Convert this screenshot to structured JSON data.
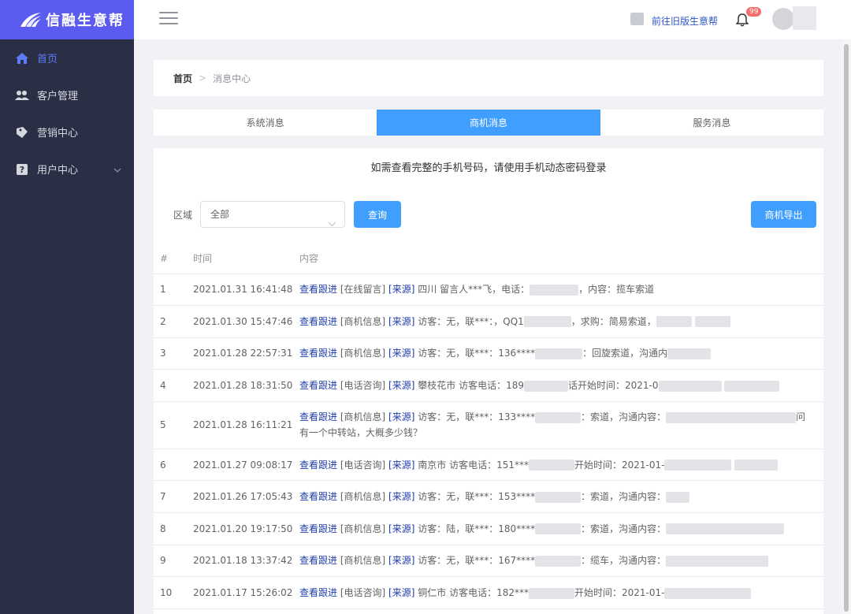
{
  "app": {
    "logo_text": "信融生意帮"
  },
  "sidebar": {
    "items": [
      {
        "label": "首页",
        "icon": "home-icon",
        "active": true
      },
      {
        "label": "客户管理",
        "icon": "users-icon",
        "active": false
      },
      {
        "label": "营销中心",
        "icon": "tag-icon",
        "active": false
      },
      {
        "label": "用户中心",
        "icon": "help-icon",
        "active": false
      }
    ]
  },
  "topbar": {
    "old_version_link": "前往旧版生意帮",
    "notification_count": "99"
  },
  "breadcrumb": {
    "home": "首页",
    "separator": ">",
    "current": "消息中心"
  },
  "tabs": [
    {
      "label": "系统消息",
      "active": false
    },
    {
      "label": "商机消息",
      "active": true
    },
    {
      "label": "服务消息",
      "active": false
    }
  ],
  "notice": "如需查看完整的手机号码，请使用手机动态密码登录",
  "filter": {
    "label": "区域",
    "selected": "全部",
    "query_button": "查询",
    "export_button": "商机导出"
  },
  "table": {
    "headers": [
      "#",
      "时间",
      "内容"
    ],
    "follow_label": "查看跟进",
    "rows": [
      {
        "index": "1",
        "time": "2021.01.31 16:41:48",
        "type": "[在线留言]",
        "source": "[来源]",
        "text_a": "四川 留言人***飞，电话：",
        "text_b": "，内容：揽车索道",
        "text_c": ""
      },
      {
        "index": "2",
        "time": "2021.01.30 15:47:46",
        "type": "[商机信息]",
        "source": "[来源]",
        "text_a": "访客：无，联***：，QQ1",
        "text_b": "，求购：简易索道，",
        "text_c": ""
      },
      {
        "index": "3",
        "time": "2021.01.28 22:57:31",
        "type": "[商机信息]",
        "source": "[来源]",
        "text_a": "访客：无，联***：136****",
        "text_b": "：回旋索道，沟通内",
        "text_c": ""
      },
      {
        "index": "4",
        "time": "2021.01.28 18:31:50",
        "type": "[电话咨询]",
        "source": "[来源]",
        "text_a": "攀枝花市 访客电话：189",
        "text_b": "话开始时间：2021-0",
        "text_c": ""
      },
      {
        "index": "5",
        "time": "2021.01.28 16:11:21",
        "type": "[商机信息]",
        "source": "[来源]",
        "text_a": "访客：无，联***：133****",
        "text_b": "：索道，沟通内容：",
        "text_c": "问",
        "text_line2": "有一个中转站，大概多少钱？"
      },
      {
        "index": "6",
        "time": "2021.01.27 09:08:17",
        "type": "[电话咨询]",
        "source": "[来源]",
        "text_a": "南京市 访客电话：151***",
        "text_b": "开始时间：2021-01-",
        "text_c": ""
      },
      {
        "index": "7",
        "time": "2021.01.26 17:05:43",
        "type": "[商机信息]",
        "source": "[来源]",
        "text_a": "访客：无，联***：153****",
        "text_b": "：索道，沟通内容：",
        "text_c": ""
      },
      {
        "index": "8",
        "time": "2021.01.20 19:17:50",
        "type": "[商机信息]",
        "source": "[来源]",
        "text_a": "访客：陆，联***：180****",
        "text_b": "：索道，沟通内容：",
        "text_c": ""
      },
      {
        "index": "9",
        "time": "2021.01.18 13:37:42",
        "type": "[商机信息]",
        "source": "[来源]",
        "text_a": "访客：无，联***：167****",
        "text_b": "：缆车，沟通内容：",
        "text_c": ""
      },
      {
        "index": "10",
        "time": "2021.01.17 15:26:02",
        "type": "[电话咨询]",
        "source": "[来源]",
        "text_a": "铜仁市 访客电话：182***",
        "text_b": "开始时间：2021-01-",
        "text_c": ""
      }
    ]
  }
}
